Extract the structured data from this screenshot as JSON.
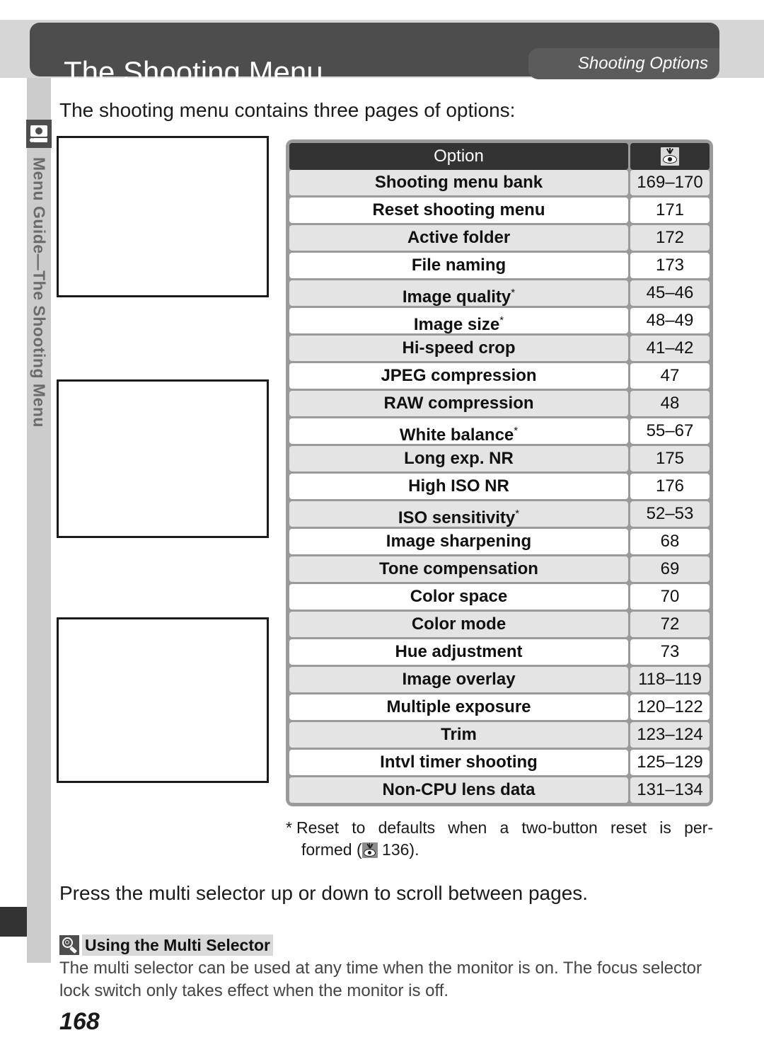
{
  "header": {
    "title": "The Shooting Menu",
    "subtab": "Shooting Options"
  },
  "sidebar": {
    "icon": "camera-icon",
    "label": "Menu Guide—The Shooting Menu"
  },
  "intro_text": "The shooting menu contains three pages of options:",
  "screenshots": [
    {
      "name": "shooting-menu-page-1",
      "caption": ""
    },
    {
      "name": "shooting-menu-page-2",
      "caption": ""
    },
    {
      "name": "shooting-menu-page-3",
      "caption": ""
    }
  ],
  "table": {
    "columns": [
      "Option",
      "see-page-icon"
    ],
    "rows": [
      {
        "option": "Shooting menu bank",
        "star": false,
        "page": "169–170"
      },
      {
        "option": "Reset shooting menu",
        "star": false,
        "page": "171"
      },
      {
        "option": "Active folder",
        "star": false,
        "page": "172"
      },
      {
        "option": "File naming",
        "star": false,
        "page": "173"
      },
      {
        "option": "Image quality",
        "star": true,
        "page": "45–46"
      },
      {
        "option": "Image size",
        "star": true,
        "page": "48–49"
      },
      {
        "option": "Hi-speed crop",
        "star": false,
        "page": "41–42"
      },
      {
        "option": "JPEG compression",
        "star": false,
        "page": "47"
      },
      {
        "option": "RAW compression",
        "star": false,
        "page": "48"
      },
      {
        "option": "White balance",
        "star": true,
        "page": "55–67"
      },
      {
        "option": "Long exp. NR",
        "star": false,
        "page": "175"
      },
      {
        "option": "High ISO NR",
        "star": false,
        "page": "176"
      },
      {
        "option": "ISO sensitivity",
        "star": true,
        "page": "52–53"
      },
      {
        "option": "Image sharpening",
        "star": false,
        "page": "68"
      },
      {
        "option": "Tone compensation",
        "star": false,
        "page": "69"
      },
      {
        "option": "Color space",
        "star": false,
        "page": "70"
      },
      {
        "option": "Color mode",
        "star": false,
        "page": "72"
      },
      {
        "option": "Hue adjustment",
        "star": false,
        "page": "73"
      },
      {
        "option": "Image overlay",
        "star": false,
        "page": "118–119"
      },
      {
        "option": "Multiple exposure",
        "star": false,
        "page": "120–122"
      },
      {
        "option": "Trim",
        "star": false,
        "page": "123–124"
      },
      {
        "option": "Intvl timer shooting",
        "star": false,
        "page": "125–129"
      },
      {
        "option": "Non-CPU lens data",
        "star": false,
        "page": "131–134"
      }
    ]
  },
  "footnote": {
    "marker": "*",
    "line1": "Reset to defaults when a two-button reset is per-",
    "line2_prefix": "formed (",
    "line2_page": "136",
    "line2_suffix": ")."
  },
  "press_text": "Press the multi selector up or down to scroll between pages.",
  "tip": {
    "icon": "magnifier-tip-icon",
    "title": "Using the Multi Selector",
    "body": "The multi selector can be used at any time when the monitor is on.  The focus selector lock switch only takes effect when the monitor is off."
  },
  "page_number": "168"
}
